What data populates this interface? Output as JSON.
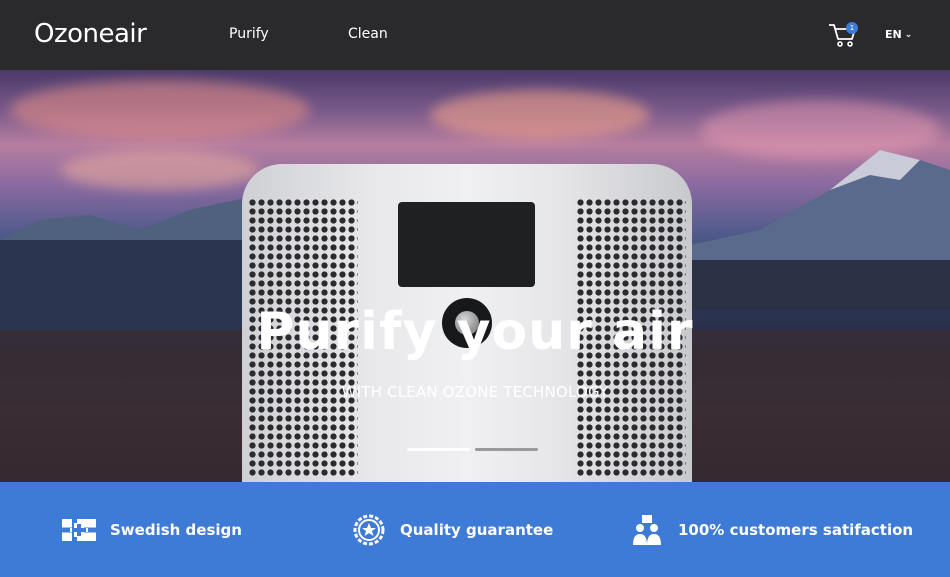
{
  "header": {
    "logo": "Ozoneair",
    "nav": [
      {
        "label": "Purify"
      },
      {
        "label": "Clean"
      }
    ],
    "cart_count": "1",
    "language": "EN"
  },
  "hero": {
    "title": "Purify your air",
    "subtitle": "WITH CLEAN OZONE TECHNOLOGY",
    "slides": [
      {
        "active": true
      },
      {
        "active": false
      }
    ]
  },
  "features": [
    {
      "label": "Swedish design",
      "icon": "swedish-flag-icon"
    },
    {
      "label": "Quality guarantee",
      "icon": "star-badge-icon"
    },
    {
      "label": "100% customers satifaction",
      "icon": "customers-icon"
    }
  ],
  "colors": {
    "header_bg": "#2a2a2c",
    "accent_blue": "#3e7bd6"
  }
}
